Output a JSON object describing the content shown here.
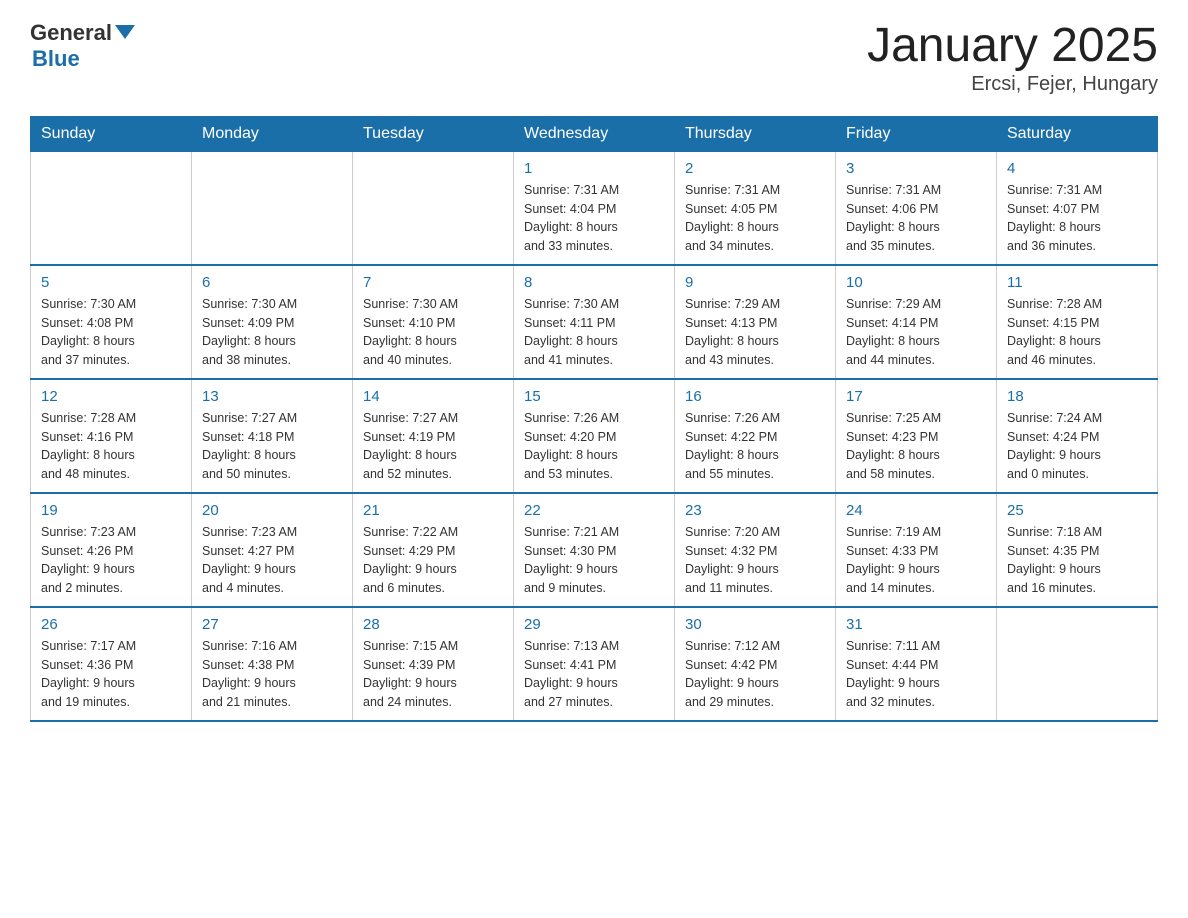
{
  "header": {
    "logo_general": "General",
    "logo_blue": "Blue",
    "title": "January 2025",
    "subtitle": "Ercsi, Fejer, Hungary"
  },
  "weekdays": [
    "Sunday",
    "Monday",
    "Tuesday",
    "Wednesday",
    "Thursday",
    "Friday",
    "Saturday"
  ],
  "weeks": [
    [
      {
        "day": "",
        "info": ""
      },
      {
        "day": "",
        "info": ""
      },
      {
        "day": "",
        "info": ""
      },
      {
        "day": "1",
        "info": "Sunrise: 7:31 AM\nSunset: 4:04 PM\nDaylight: 8 hours\nand 33 minutes."
      },
      {
        "day": "2",
        "info": "Sunrise: 7:31 AM\nSunset: 4:05 PM\nDaylight: 8 hours\nand 34 minutes."
      },
      {
        "day": "3",
        "info": "Sunrise: 7:31 AM\nSunset: 4:06 PM\nDaylight: 8 hours\nand 35 minutes."
      },
      {
        "day": "4",
        "info": "Sunrise: 7:31 AM\nSunset: 4:07 PM\nDaylight: 8 hours\nand 36 minutes."
      }
    ],
    [
      {
        "day": "5",
        "info": "Sunrise: 7:30 AM\nSunset: 4:08 PM\nDaylight: 8 hours\nand 37 minutes."
      },
      {
        "day": "6",
        "info": "Sunrise: 7:30 AM\nSunset: 4:09 PM\nDaylight: 8 hours\nand 38 minutes."
      },
      {
        "day": "7",
        "info": "Sunrise: 7:30 AM\nSunset: 4:10 PM\nDaylight: 8 hours\nand 40 minutes."
      },
      {
        "day": "8",
        "info": "Sunrise: 7:30 AM\nSunset: 4:11 PM\nDaylight: 8 hours\nand 41 minutes."
      },
      {
        "day": "9",
        "info": "Sunrise: 7:29 AM\nSunset: 4:13 PM\nDaylight: 8 hours\nand 43 minutes."
      },
      {
        "day": "10",
        "info": "Sunrise: 7:29 AM\nSunset: 4:14 PM\nDaylight: 8 hours\nand 44 minutes."
      },
      {
        "day": "11",
        "info": "Sunrise: 7:28 AM\nSunset: 4:15 PM\nDaylight: 8 hours\nand 46 minutes."
      }
    ],
    [
      {
        "day": "12",
        "info": "Sunrise: 7:28 AM\nSunset: 4:16 PM\nDaylight: 8 hours\nand 48 minutes."
      },
      {
        "day": "13",
        "info": "Sunrise: 7:27 AM\nSunset: 4:18 PM\nDaylight: 8 hours\nand 50 minutes."
      },
      {
        "day": "14",
        "info": "Sunrise: 7:27 AM\nSunset: 4:19 PM\nDaylight: 8 hours\nand 52 minutes."
      },
      {
        "day": "15",
        "info": "Sunrise: 7:26 AM\nSunset: 4:20 PM\nDaylight: 8 hours\nand 53 minutes."
      },
      {
        "day": "16",
        "info": "Sunrise: 7:26 AM\nSunset: 4:22 PM\nDaylight: 8 hours\nand 55 minutes."
      },
      {
        "day": "17",
        "info": "Sunrise: 7:25 AM\nSunset: 4:23 PM\nDaylight: 8 hours\nand 58 minutes."
      },
      {
        "day": "18",
        "info": "Sunrise: 7:24 AM\nSunset: 4:24 PM\nDaylight: 9 hours\nand 0 minutes."
      }
    ],
    [
      {
        "day": "19",
        "info": "Sunrise: 7:23 AM\nSunset: 4:26 PM\nDaylight: 9 hours\nand 2 minutes."
      },
      {
        "day": "20",
        "info": "Sunrise: 7:23 AM\nSunset: 4:27 PM\nDaylight: 9 hours\nand 4 minutes."
      },
      {
        "day": "21",
        "info": "Sunrise: 7:22 AM\nSunset: 4:29 PM\nDaylight: 9 hours\nand 6 minutes."
      },
      {
        "day": "22",
        "info": "Sunrise: 7:21 AM\nSunset: 4:30 PM\nDaylight: 9 hours\nand 9 minutes."
      },
      {
        "day": "23",
        "info": "Sunrise: 7:20 AM\nSunset: 4:32 PM\nDaylight: 9 hours\nand 11 minutes."
      },
      {
        "day": "24",
        "info": "Sunrise: 7:19 AM\nSunset: 4:33 PM\nDaylight: 9 hours\nand 14 minutes."
      },
      {
        "day": "25",
        "info": "Sunrise: 7:18 AM\nSunset: 4:35 PM\nDaylight: 9 hours\nand 16 minutes."
      }
    ],
    [
      {
        "day": "26",
        "info": "Sunrise: 7:17 AM\nSunset: 4:36 PM\nDaylight: 9 hours\nand 19 minutes."
      },
      {
        "day": "27",
        "info": "Sunrise: 7:16 AM\nSunset: 4:38 PM\nDaylight: 9 hours\nand 21 minutes."
      },
      {
        "day": "28",
        "info": "Sunrise: 7:15 AM\nSunset: 4:39 PM\nDaylight: 9 hours\nand 24 minutes."
      },
      {
        "day": "29",
        "info": "Sunrise: 7:13 AM\nSunset: 4:41 PM\nDaylight: 9 hours\nand 27 minutes."
      },
      {
        "day": "30",
        "info": "Sunrise: 7:12 AM\nSunset: 4:42 PM\nDaylight: 9 hours\nand 29 minutes."
      },
      {
        "day": "31",
        "info": "Sunrise: 7:11 AM\nSunset: 4:44 PM\nDaylight: 9 hours\nand 32 minutes."
      },
      {
        "day": "",
        "info": ""
      }
    ]
  ]
}
